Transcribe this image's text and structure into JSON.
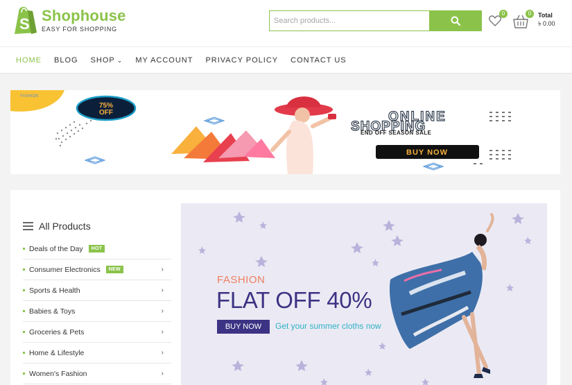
{
  "brand": {
    "name": "Shophouse",
    "tagline": "EASY FOR SHOPPING",
    "color": "#8bc34a"
  },
  "search": {
    "placeholder": "Search products...",
    "button_icon": "search-icon"
  },
  "header_icons": {
    "wishlist_count": "0",
    "cart_count": "0",
    "cart_total_label": "Total",
    "cart_total_amount": "৳ 0.00"
  },
  "nav": {
    "items": [
      {
        "label": "HOME",
        "active": true
      },
      {
        "label": "BLOG"
      },
      {
        "label": "SHOP",
        "has_dropdown": true
      },
      {
        "label": "MY ACCOUNT"
      },
      {
        "label": "PRIVACY POLICY"
      },
      {
        "label": "CONTACT US"
      }
    ]
  },
  "promo_banner": {
    "corner_label": "FASHION",
    "discount_line1": "75%",
    "discount_line2": "OFF",
    "headline1": "ONLINE",
    "headline2": "SHOPPING",
    "subline": "END OFF SEASON SALE",
    "button": "BUY NOW"
  },
  "categories": {
    "title": "All Products",
    "items": [
      {
        "label": "Deals of the Day",
        "tag": "HOT"
      },
      {
        "label": "Consumer Electronics",
        "tag": "NEW",
        "has_submenu": true
      },
      {
        "label": "Sports & Health",
        "has_submenu": true
      },
      {
        "label": "Babies & Toys",
        "has_submenu": true
      },
      {
        "label": "Groceries & Pets",
        "has_submenu": true
      },
      {
        "label": "Home & Lifestyle",
        "has_submenu": true
      },
      {
        "label": "Women's Fashion",
        "has_submenu": true
      }
    ]
  },
  "hero": {
    "subtitle": "FASHION",
    "title": "FLAT OFF 40%",
    "button": "BUY NOW",
    "cta": "Get your summer cloths now",
    "colors": {
      "subtitle": "#ef7d5f",
      "title": "#3d3384",
      "cta": "#2fb1c4",
      "background": "#ebeaf4"
    }
  }
}
